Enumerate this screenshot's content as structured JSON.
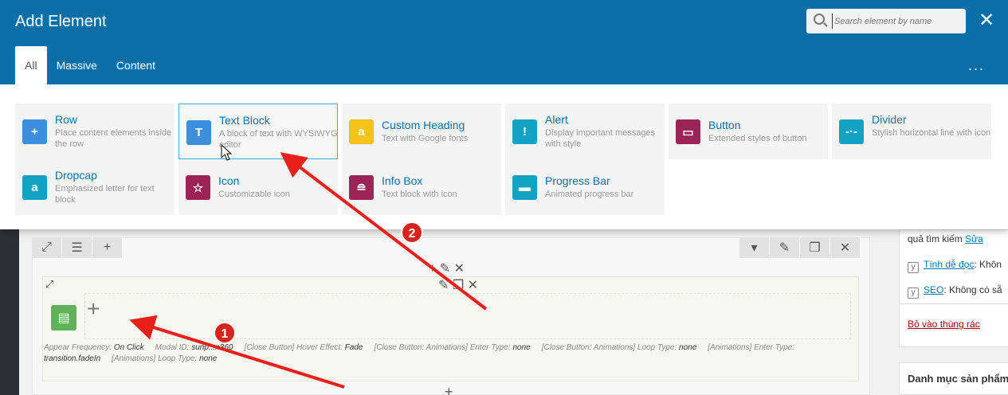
{
  "modal": {
    "title": "Add Element",
    "search_placeholder": "Search element by name",
    "close_glyph": "✕",
    "tabs": [
      {
        "label": "All",
        "active": true
      },
      {
        "label": "Massive",
        "active": false
      },
      {
        "label": "Content",
        "active": false
      }
    ],
    "more_glyph": "...",
    "elements": [
      {
        "name": "Row",
        "desc": "Place content elements inside the row",
        "icon": "plus-icon",
        "glyph": "+",
        "color": "#3d8edb"
      },
      {
        "name": "Text Block",
        "desc": "A block of text with WYSIWYG editor",
        "icon": "text-t-icon",
        "glyph": "T",
        "color": "#3d8edb"
      },
      {
        "name": "Custom Heading",
        "desc": "Text with Google fonts",
        "icon": "letter-a-icon",
        "glyph": "a",
        "color": "#f3c319"
      },
      {
        "name": "Alert",
        "desc": "Display important messages with style",
        "icon": "alert-icon",
        "glyph": "!",
        "color": "#11a2c4"
      },
      {
        "name": "Button",
        "desc": "Extended styles of button",
        "icon": "button-icon",
        "glyph": "▭",
        "color": "#9b2356"
      },
      {
        "name": "Divider",
        "desc": "Stylish horizontal line with icon",
        "icon": "divider-icon",
        "glyph": "-·-",
        "color": "#11a2c4"
      },
      {
        "name": "Dropcap",
        "desc": "Emphasized letter for text block",
        "icon": "dropcap-icon",
        "glyph": "a",
        "color": "#11a2c4"
      },
      {
        "name": "Icon",
        "desc": "Customizable icon",
        "icon": "star-icon",
        "glyph": "☆",
        "color": "#9b2356"
      },
      {
        "name": "Info Box",
        "desc": "Text block with icon",
        "icon": "info-box-icon",
        "glyph": "≘",
        "color": "#9b2356"
      },
      {
        "name": "Progress Bar",
        "desc": "Animated progress bar",
        "icon": "progress-bar-icon",
        "glyph": "▬",
        "color": "#11a2c4"
      }
    ]
  },
  "editor": {
    "params": [
      {
        "key": "Appear Frequency:",
        "val": "On Click"
      },
      {
        "key": "Modal ID:",
        "val": "sunp...n360"
      },
      {
        "key": "[Close Button] Hover Effect:",
        "val": "Fade"
      },
      {
        "key": "[Close Button: Animations] Enter Type:",
        "val": "none"
      },
      {
        "key": "[Close Button: Animations] Loop Type:",
        "val": "none"
      },
      {
        "key": "[Animations] Enter Type:",
        "val": "transition.fadeIn"
      },
      {
        "key": "[Animations] Loop Type:",
        "val": "none"
      }
    ]
  },
  "sidebar": {
    "search_result_prefix": "quả tìm kiếm",
    "edit_link": "Sửa",
    "readability_link": "Tính dễ đọc",
    "readability_value": ": Khôn",
    "seo_link": "SEO",
    "seo_value": ": Không có sẵ",
    "trash_link": "Bỏ vào thùng rác",
    "categories_title": "Danh mục sản phẩm"
  },
  "annotations": {
    "marker_1": "1",
    "marker_2": "2"
  },
  "colors": {
    "header": "#0a6fa6",
    "hover_border": "#35b5d4",
    "arrow": "#e8201c"
  }
}
